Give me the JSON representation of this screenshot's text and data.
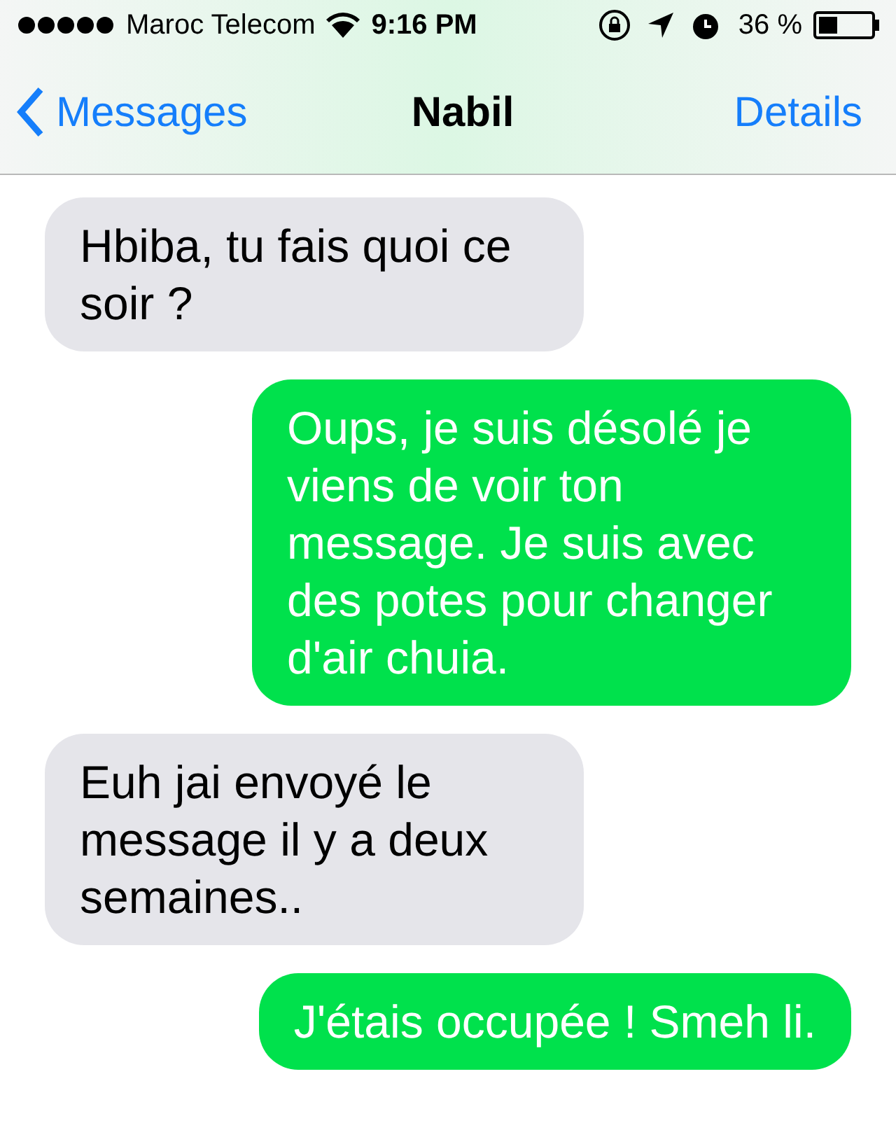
{
  "status_bar": {
    "carrier": "Maroc Telecom",
    "time": "9:16 PM",
    "battery": "36 %"
  },
  "nav": {
    "back": "Messages",
    "title": "Nabil",
    "action": "Details"
  },
  "messages": [
    {
      "kind": "received",
      "text": "Hbiba, tu fais quoi ce soir ?"
    },
    {
      "kind": "sent",
      "text": "Oups, je suis désolé je viens de voir ton message. Je suis avec des potes pour changer d'air chuia."
    },
    {
      "kind": "received",
      "text": "Euh jai envoyé le message il y a deux semaines.."
    },
    {
      "kind": "sent",
      "text": "J'étais occupée ! Smeh li."
    }
  ]
}
